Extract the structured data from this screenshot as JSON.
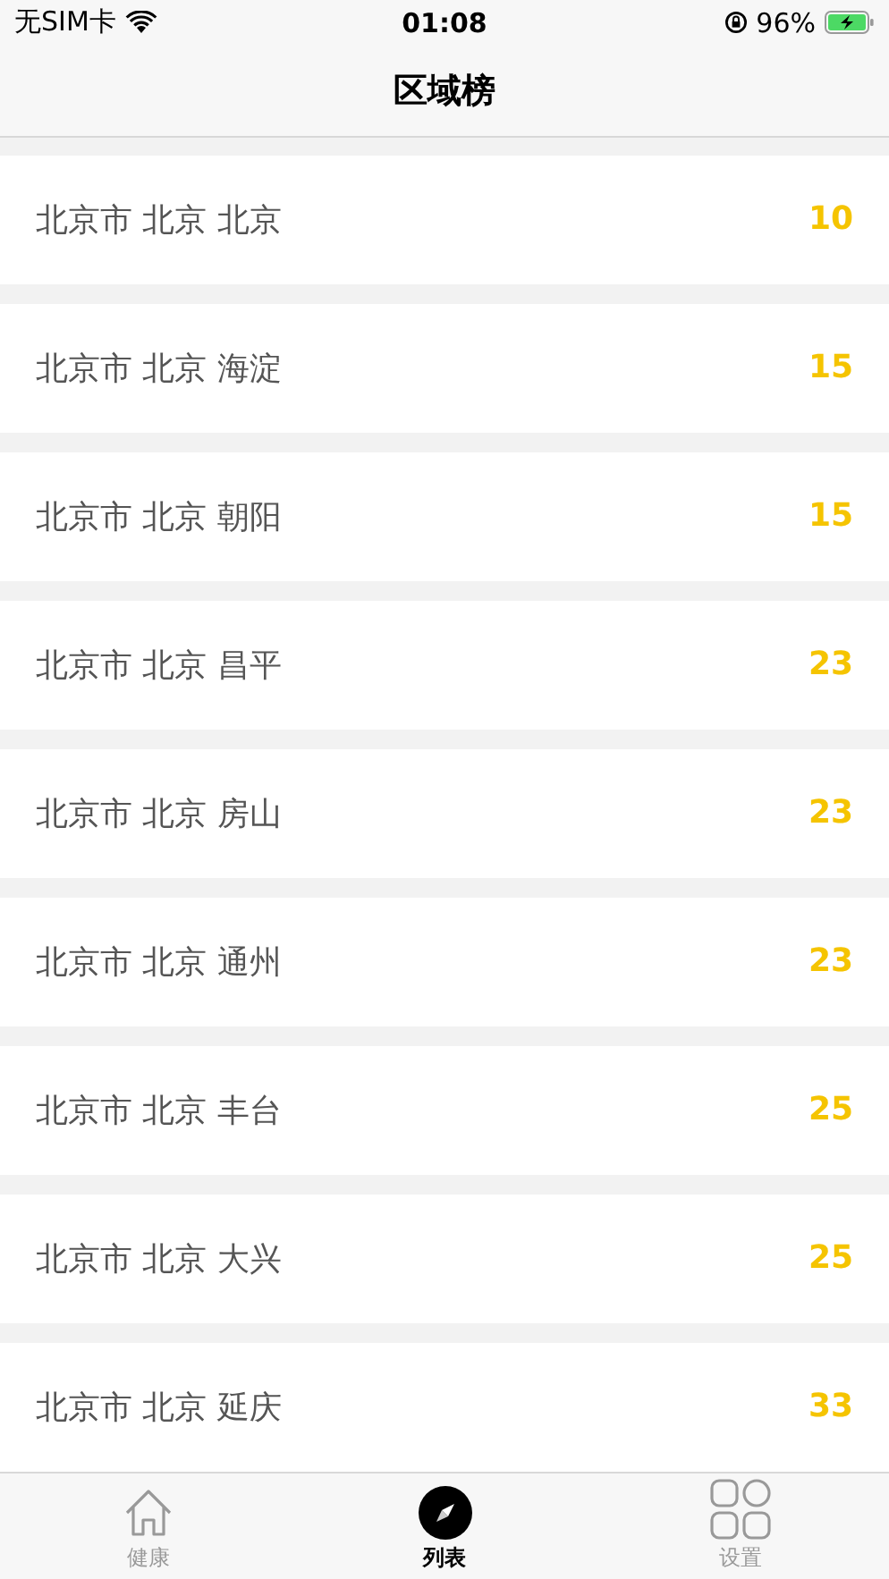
{
  "status_bar": {
    "carrier": "无SIM卡",
    "time": "01:08",
    "battery": "96%"
  },
  "title": "区域榜",
  "rows": [
    {
      "region": "北京市 北京 北京",
      "count": "10"
    },
    {
      "region": "北京市 北京 海淀",
      "count": "15"
    },
    {
      "region": "北京市 北京 朝阳",
      "count": "15"
    },
    {
      "region": "北京市 北京 昌平",
      "count": "23"
    },
    {
      "region": "北京市 北京 房山",
      "count": "23"
    },
    {
      "region": "北京市 北京 通州",
      "count": "23"
    },
    {
      "region": "北京市 北京 丰台",
      "count": "25"
    },
    {
      "region": "北京市 北京 大兴",
      "count": "25"
    },
    {
      "region": "北京市 北京 延庆",
      "count": "33"
    }
  ],
  "tabs": [
    {
      "label": "健康",
      "selected": false
    },
    {
      "label": "列表",
      "selected": true
    },
    {
      "label": "设置",
      "selected": false
    }
  ]
}
